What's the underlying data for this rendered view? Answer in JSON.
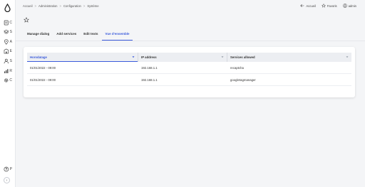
{
  "breadcrumb": {
    "items": [
      "Accueil",
      "Administration",
      "Configuration",
      "Système"
    ],
    "separator": ">"
  },
  "top_actions": {
    "back_label": "Accueil",
    "favorites_label": "Favoris",
    "user_label": "admin"
  },
  "sidebar": {
    "items": [
      {
        "icon": "document-icon",
        "label": "C"
      },
      {
        "icon": "layers-icon",
        "label": "S"
      },
      {
        "icon": "location-icon",
        "label": "A"
      },
      {
        "icon": "building-icon",
        "label": "E"
      },
      {
        "icon": "user-icon",
        "label": "S"
      },
      {
        "icon": "chart-icon",
        "label": "R"
      },
      {
        "icon": "gear-icon",
        "label": "C"
      }
    ],
    "help_label": "P",
    "expand_glyph": "›"
  },
  "tabs": [
    {
      "label": "Manage dialog",
      "active": false
    },
    {
      "label": "Add services",
      "active": false
    },
    {
      "label": "Edit texts",
      "active": false
    },
    {
      "label": "Vue d'ensemble",
      "active": true
    }
  ],
  "table": {
    "columns": [
      {
        "label": "Horodatage",
        "sorted": true,
        "filter_glyph": "▾"
      },
      {
        "label": "IP address",
        "sorted": false,
        "filter_glyph": "▾"
      },
      {
        "label": "Services allowed",
        "sorted": false,
        "filter_glyph": "▾"
      }
    ],
    "rows": [
      {
        "timestamp": "01/01/2022 - 09:00",
        "ip": "192.168.1.1",
        "services": "recaptcha"
      },
      {
        "timestamp": "01/01/2022 - 09:00",
        "ip": "192.168.1.1",
        "services": "googletagmanager"
      }
    ]
  },
  "colors": {
    "accent": "#3b5bdb",
    "header_bg": "#eceef2",
    "page_bg": "#f4f5f7"
  }
}
